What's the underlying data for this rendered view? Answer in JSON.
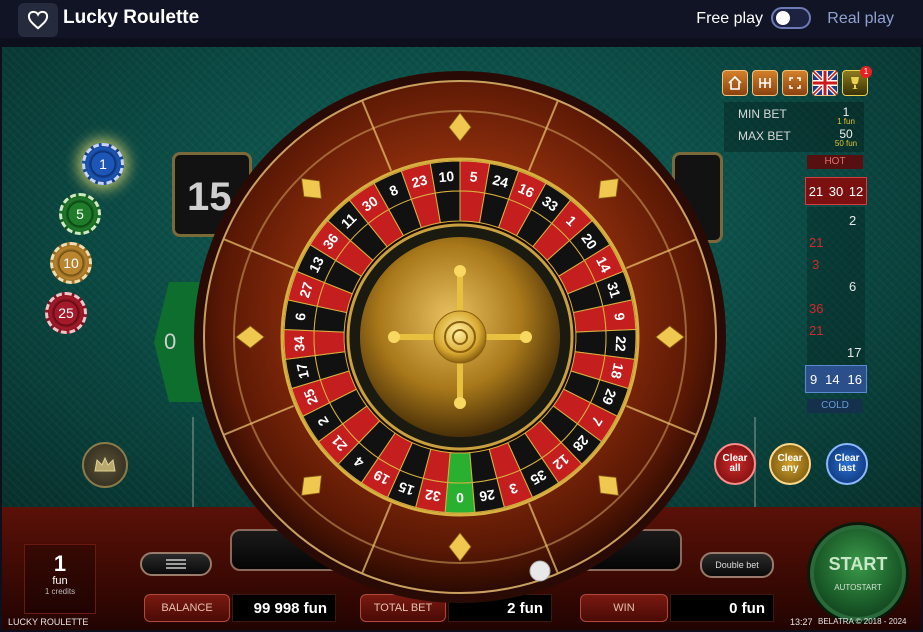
{
  "header": {
    "title": "Lucky Roulette",
    "free_play_label": "Free play",
    "real_play_label": "Real play",
    "toggle_state": "free"
  },
  "game": {
    "chips": [
      "1",
      "5",
      "10",
      "25"
    ],
    "display_left": "15",
    "zero_label": "0",
    "toolbar": {
      "notification_count": "1"
    },
    "limits": {
      "min_bet_label": "MIN BET",
      "min_bet_value": "1",
      "min_bet_sub": "1 fun",
      "max_bet_label": "MAX BET",
      "max_bet_value": "50",
      "max_bet_sub": "50 fun"
    },
    "stats_panel": {
      "hot_label": "HOT",
      "hot_numbers": [
        "21",
        "30",
        "12"
      ],
      "history": [
        {
          "value": "2",
          "color": "black"
        },
        {
          "value": "21",
          "color": "red"
        },
        {
          "value": "3",
          "color": "red"
        },
        {
          "value": "6",
          "color": "black"
        },
        {
          "value": "36",
          "color": "red"
        },
        {
          "value": "21",
          "color": "red"
        },
        {
          "value": "17",
          "color": "black"
        }
      ],
      "cold_numbers": [
        "9",
        "14",
        "16"
      ],
      "cold_label": "COLD"
    },
    "clear_buttons": {
      "all": "Clear all",
      "any": "Clear any",
      "last": "Clear last"
    },
    "wheel": {
      "numbers": [
        "0",
        "32",
        "15",
        "19",
        "4",
        "21",
        "2",
        "25",
        "17",
        "34",
        "6",
        "27",
        "13",
        "36",
        "11",
        "30",
        "8",
        "23",
        "10",
        "5",
        "24",
        "16",
        "33",
        "1",
        "20",
        "14",
        "31",
        "9",
        "22",
        "18",
        "29",
        "7",
        "28",
        "12",
        "35",
        "3",
        "26"
      ]
    }
  },
  "bottom": {
    "coin_value": "1",
    "coin_unit": "fun",
    "coin_sub": "1 credits",
    "double_bet_label": "Double bet",
    "balance_label": "BALANCE",
    "balance_value": "99 998 fun",
    "total_bet_label": "TOTAL BET",
    "total_bet_value": "2 fun",
    "win_label": "WIN",
    "win_value": "0 fun",
    "start_label": "START",
    "autostart_label": "AUTOSTART"
  },
  "footer": {
    "game_name": "LUCKY ROULETTE",
    "time": "13:27",
    "copyright": "BELATRA © 2018 - 2024"
  },
  "colors": {
    "felt": "#0b4a44",
    "wheel_wood": "#7a2a0c",
    "gold": "#d8b040",
    "red": "#c41e1e",
    "black": "#111111",
    "green": "#2ab030"
  }
}
